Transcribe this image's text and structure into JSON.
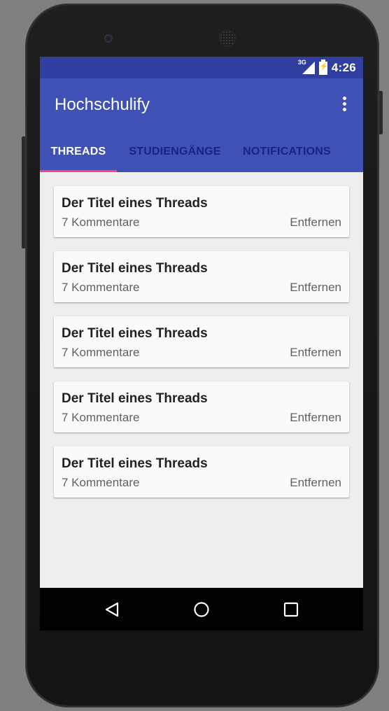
{
  "device": {
    "camera_icon": "front-camera",
    "speaker_icon": "earpiece-speaker"
  },
  "status_bar": {
    "network_label": "3G",
    "network_icon": "signal-icon",
    "battery_icon": "battery-charging-icon",
    "time": "4:26"
  },
  "app_bar": {
    "title": "Hochschulify",
    "menu_icon": "overflow-menu-icon"
  },
  "tabs": [
    {
      "label": "THREADS",
      "active": true
    },
    {
      "label": "STUDIENGÄNGE",
      "active": false
    },
    {
      "label": "NOTIFICATIONS",
      "active": false
    }
  ],
  "threads": [
    {
      "title": "Der Titel eines Threads",
      "comments": "7 Kommentare",
      "remove_label": "Entfernen"
    },
    {
      "title": "Der Titel eines Threads",
      "comments": "7 Kommentare",
      "remove_label": "Entfernen"
    },
    {
      "title": "Der Titel eines Threads",
      "comments": "7 Kommentare",
      "remove_label": "Entfernen"
    },
    {
      "title": "Der Titel eines Threads",
      "comments": "7 Kommentare",
      "remove_label": "Entfernen"
    },
    {
      "title": "Der Titel eines Threads",
      "comments": "7 Kommentare",
      "remove_label": "Entfernen"
    }
  ],
  "nav_bar": {
    "back_icon": "back-icon",
    "home_icon": "home-icon",
    "recents_icon": "recents-icon"
  },
  "colors": {
    "primary": "#3f51b5",
    "primary_dark": "#303f9f",
    "accent": "#ff4081",
    "background": "#eeeeee"
  }
}
